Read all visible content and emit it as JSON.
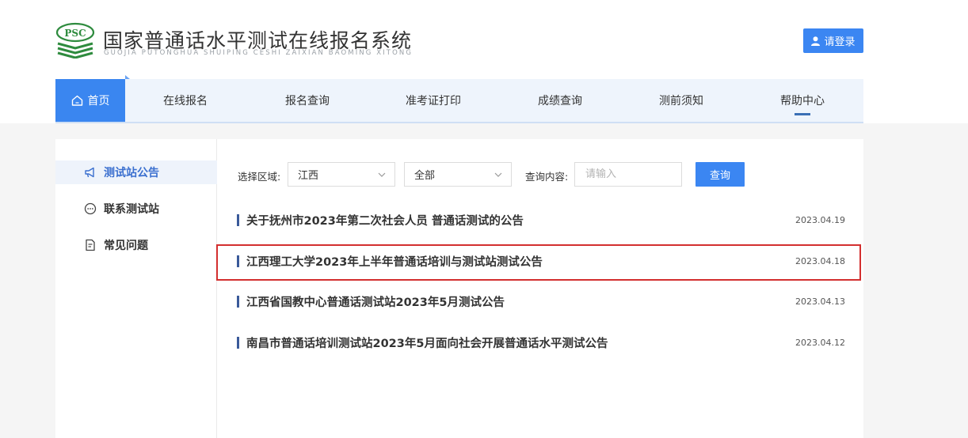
{
  "header": {
    "brand_logo_text": "PSC",
    "brand_title": "国家普通话水平测试在线报名系统",
    "brand_subtitle": "GUOJIA PUTONGHUA SHUIPING CESHI ZAIXIAN BAOMING XITONG",
    "login_label": "请登录"
  },
  "nav": {
    "home": "首页",
    "online_register": "在线报名",
    "register_query": "报名查询",
    "admission_print": "准考证打印",
    "score_query": "成绩查询",
    "test_notice": "测前须知",
    "help_center": "帮助中心"
  },
  "sidebar": {
    "items": [
      {
        "label": "测试站公告",
        "icon": "megaphone-icon",
        "active": true
      },
      {
        "label": "联系测试站",
        "icon": "chat-icon",
        "active": false
      },
      {
        "label": "常见问题",
        "icon": "document-icon",
        "active": false
      }
    ]
  },
  "filters": {
    "region_label": "选择区域:",
    "region_value": "江西",
    "scope_value": "全部",
    "query_label": "查询内容:",
    "query_placeholder": "请输入",
    "search_label": "查询"
  },
  "announcements": [
    {
      "title": "关于抚州市2023年第二次社会人员 普通话测试的公告",
      "date": "2023.04.19"
    },
    {
      "title": "江西理工大学2023年上半年普通话培训与测试站测试公告",
      "date": "2023.04.18"
    },
    {
      "title": "江西省国教中心普通话测试站2023年5月测试公告",
      "date": "2023.04.13"
    },
    {
      "title": "南昌市普通话培训测试站2023年5月面向社会开展普通话水平测试公告",
      "date": "2023.04.12"
    }
  ],
  "colors": {
    "accent": "#3b86f2",
    "nav_bg": "#eef4fc",
    "highlight": "#d32f2f",
    "logo_green": "#2e8b3e"
  }
}
